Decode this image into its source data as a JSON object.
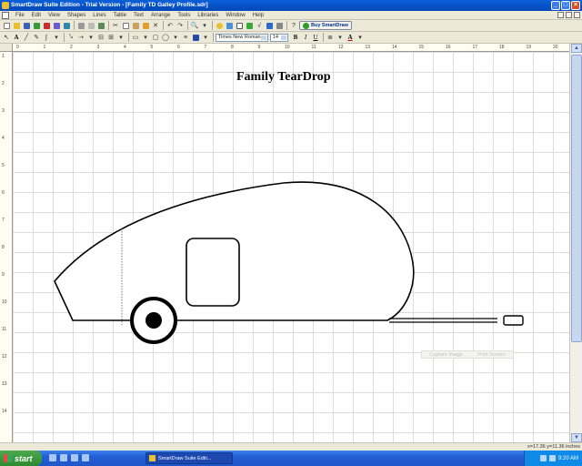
{
  "window": {
    "title": "SmartDraw Suite Edition - Trial Version - [Family TD Galley Profile.sdr]"
  },
  "menu": [
    "File",
    "Edit",
    "View",
    "Shapes",
    "Lines",
    "Table",
    "Text",
    "Arrange",
    "Tools",
    "Libraries",
    "Window",
    "Help"
  ],
  "toolbar": {
    "buy_label": "Buy SmartDraw",
    "font": "Times New Roman",
    "font_size": "14",
    "bold": "B",
    "italic": "I",
    "underline": "U",
    "text_color": "A"
  },
  "ruler": {
    "h_numbers": [
      "0",
      "1",
      "2",
      "3",
      "4",
      "5",
      "6",
      "7",
      "8",
      "9",
      "10",
      "11",
      "12",
      "13",
      "14",
      "15",
      "16",
      "17",
      "18",
      "19",
      "20"
    ],
    "v_numbers": [
      "1",
      "2",
      "3",
      "4",
      "5",
      "6",
      "7",
      "8",
      "9",
      "10",
      "11",
      "12",
      "13",
      "14"
    ]
  },
  "diagram": {
    "title": "Family TearDrop",
    "colors": {
      "stroke": "#000000",
      "hitch": "#000000",
      "grid": "#dcdcdc"
    }
  },
  "capture": {
    "capture_label": "Capture Image",
    "print_label": "Print Screen"
  },
  "status": {
    "coords": "x=17.36  y=11.36 inches"
  },
  "taskbar": {
    "start_label": "start",
    "task_label": "SmartDraw Suite Editi...",
    "clock": "9:20 AM"
  }
}
